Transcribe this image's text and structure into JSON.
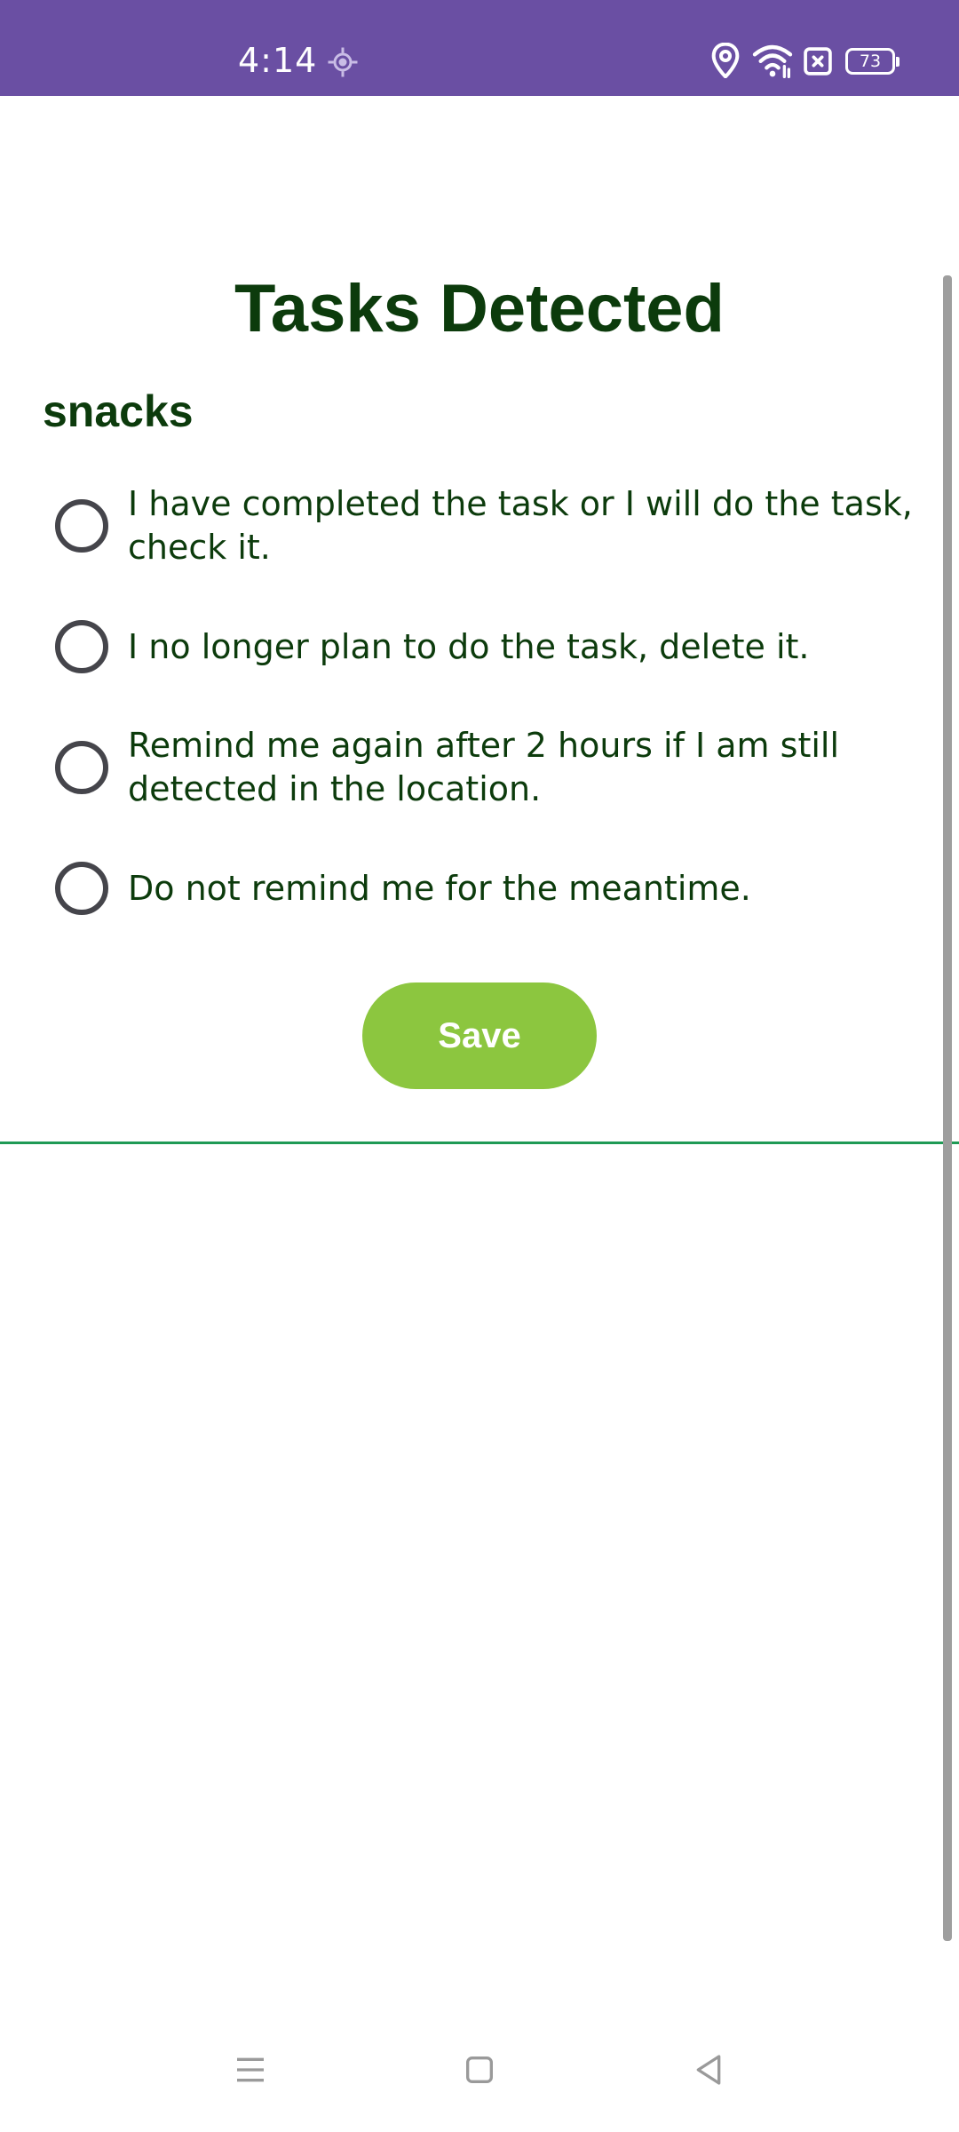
{
  "status_bar": {
    "time": "4:14",
    "battery": "73",
    "icons": [
      "location-target-icon",
      "location-pin-icon",
      "wifi-icon",
      "sim-card-icon",
      "battery-icon"
    ]
  },
  "page": {
    "title": "Tasks Detected",
    "task_name": "snacks"
  },
  "options": [
    {
      "label": "I have completed the task or I will do the task, check it.",
      "selected": false
    },
    {
      "label": "I no longer plan to do the task, delete it.",
      "selected": false
    },
    {
      "label": "Remind me again after 2 hours if I am still detected in the location.",
      "selected": false
    },
    {
      "label": "Do not remind me for the meantime.",
      "selected": false
    }
  ],
  "actions": {
    "save_label": "Save"
  },
  "colors": {
    "status_bar": "#6a4fa3",
    "title_text": "#0c3b0c",
    "save_button": "#8cc63f",
    "divider": "#1f9a55",
    "radio_border": "#45454b"
  },
  "nav_bar": {
    "icons": [
      "menu-icon",
      "home-icon",
      "back-icon"
    ]
  }
}
